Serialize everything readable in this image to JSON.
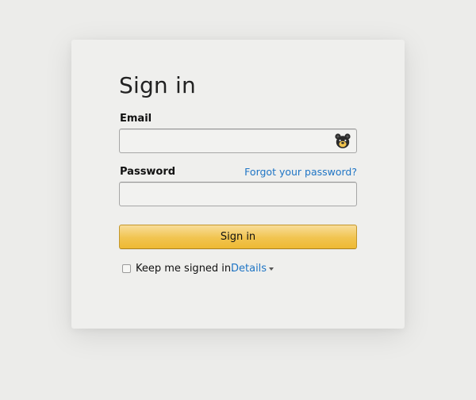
{
  "form": {
    "title": "Sign in",
    "email_label": "Email",
    "email_value": "",
    "email_placeholder": "",
    "password_label": "Password",
    "password_value": "",
    "forgot_link": "Forgot your password?",
    "submit_label": "Sign in",
    "keep_signed_in_label": "Keep me signed in.",
    "keep_signed_in_checked": false,
    "details_link": "Details",
    "password_manager_icon": "bear-icon"
  },
  "colors": {
    "background": "#ececea",
    "card": "#efefed",
    "link": "#1f75c5",
    "button_gradient_top": "#f8dd9a",
    "button_gradient_bottom": "#eeb933",
    "button_border": "#c3972b"
  }
}
